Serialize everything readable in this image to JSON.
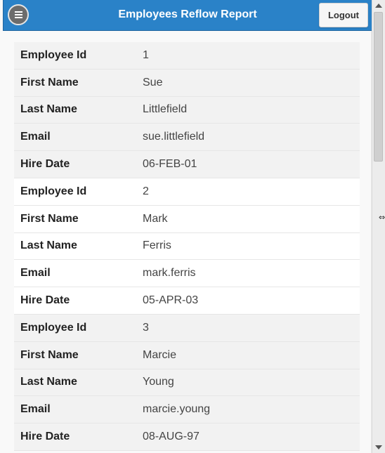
{
  "header": {
    "title": "Employees Reflow Report",
    "logout_label": "Logout"
  },
  "labels": {
    "employee_id": "Employee Id",
    "first_name": "First Name",
    "last_name": "Last Name",
    "email": "Email",
    "hire_date": "Hire Date"
  },
  "employees": [
    {
      "employee_id": "1",
      "first_name": "Sue",
      "last_name": "Littlefield",
      "email": "sue.littlefield",
      "hire_date": "06-FEB-01"
    },
    {
      "employee_id": "2",
      "first_name": "Mark",
      "last_name": "Ferris",
      "email": "mark.ferris",
      "hire_date": "05-APR-03"
    },
    {
      "employee_id": "3",
      "first_name": "Marcie",
      "last_name": "Young",
      "email": "marcie.young",
      "hire_date": "08-AUG-97"
    }
  ],
  "colors": {
    "header_bg": "#2a82c8",
    "row_odd": "#f2f2f2",
    "row_even": "#ffffff"
  },
  "icons": {
    "menu": "menu-icon",
    "scroll_up": "arrow-up-icon",
    "scroll_down": "arrow-down-icon",
    "cursor": "resize-cursor-icon"
  }
}
